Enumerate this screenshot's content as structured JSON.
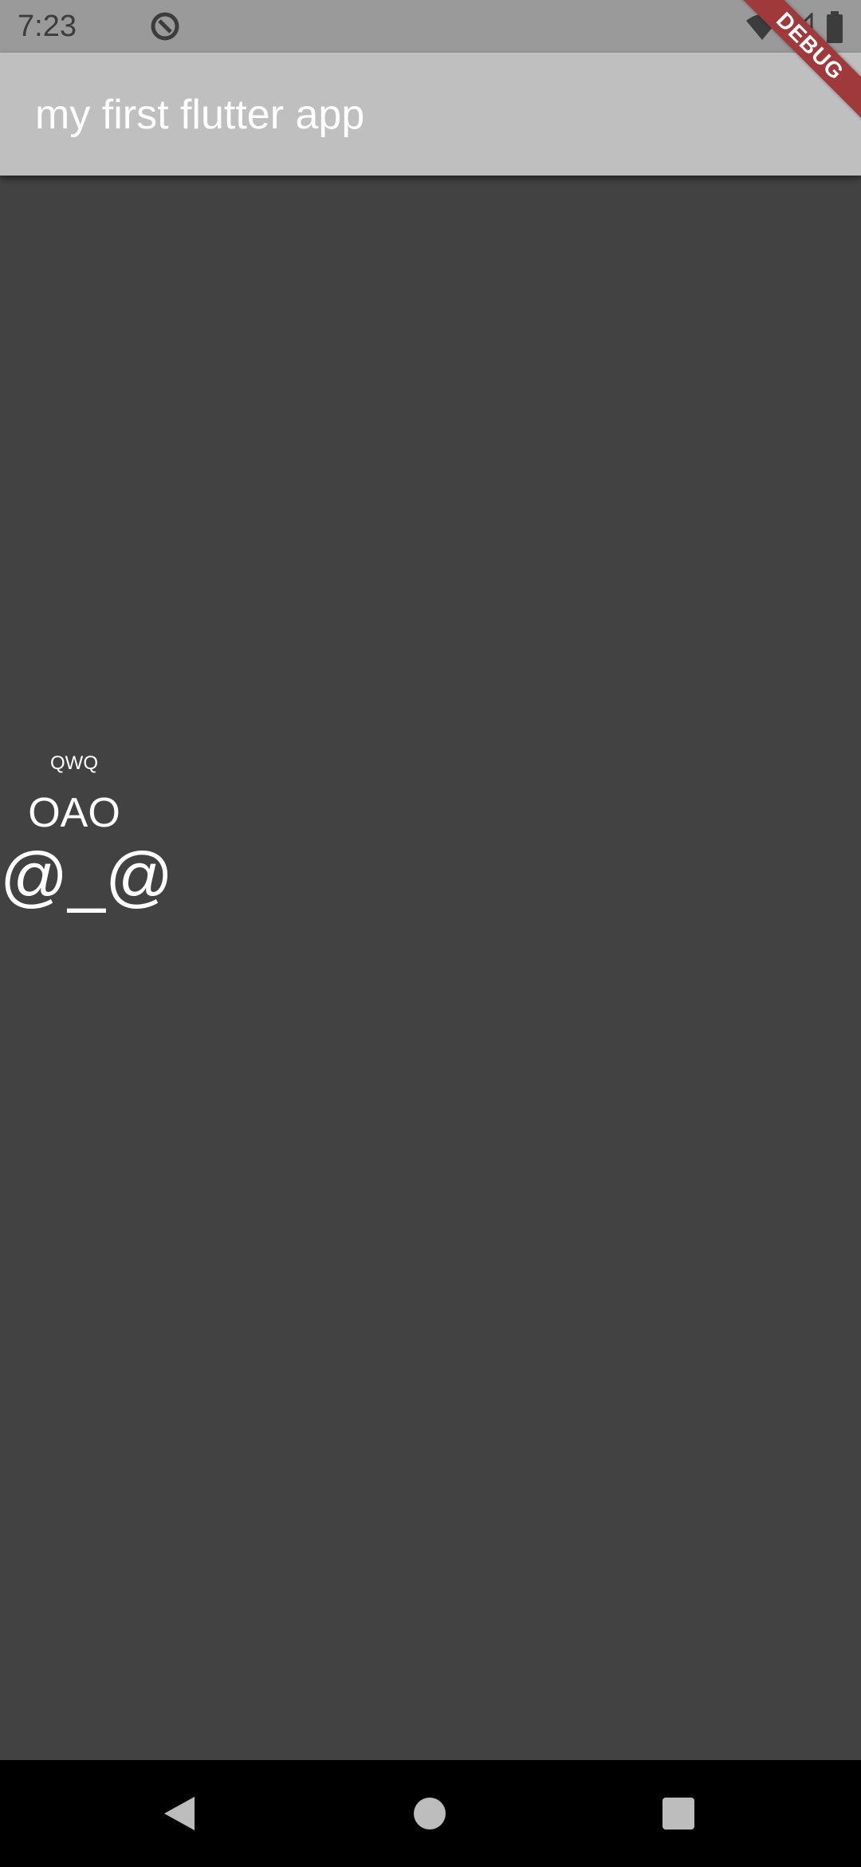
{
  "status_bar": {
    "time": "7:23",
    "icons": [
      "notification-icon",
      "wifi-icon",
      "signal-icon",
      "battery-icon"
    ]
  },
  "app_bar": {
    "title": "my first flutter app"
  },
  "debug_banner": {
    "label": "DEBUG",
    "color": "#a0393c"
  },
  "body": {
    "texts": [
      "QWQ",
      "OAO",
      "@_@"
    ],
    "background": "#424242",
    "text_color": "#ffffff"
  },
  "nav_bar": {
    "buttons": [
      "back-icon",
      "home-icon",
      "recents-icon"
    ]
  },
  "colors": {
    "status_bar": "#9a9a9a",
    "app_bar": "#bfbfbf",
    "nav_bar": "#000000"
  }
}
